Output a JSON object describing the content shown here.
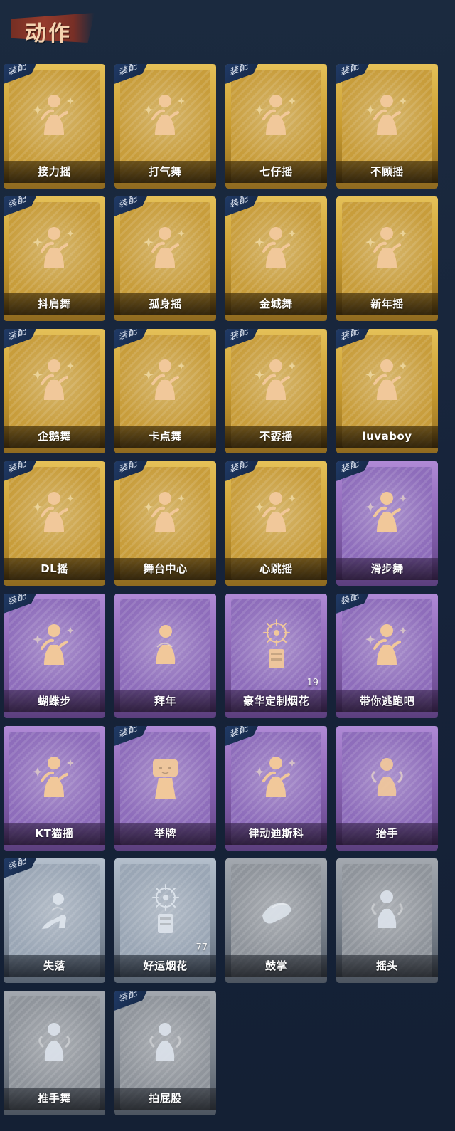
{
  "header": {
    "title": "动作"
  },
  "badge_label": "装配",
  "cards": [
    {
      "label": "接力摇",
      "equipped": true,
      "tier": "gold",
      "icon": "dance-pose-icon"
    },
    {
      "label": "打气舞",
      "equipped": true,
      "tier": "gold",
      "icon": "dance-pose-icon"
    },
    {
      "label": "七仔摇",
      "equipped": true,
      "tier": "gold",
      "icon": "dance-pose-icon"
    },
    {
      "label": "不顾摇",
      "equipped": true,
      "tier": "gold",
      "icon": "dance-pose-icon"
    },
    {
      "label": "抖肩舞",
      "equipped": true,
      "tier": "gold",
      "icon": "dance-pose-icon"
    },
    {
      "label": "孤身摇",
      "equipped": true,
      "tier": "gold",
      "icon": "dance-pose-icon"
    },
    {
      "label": "金城舞",
      "equipped": true,
      "tier": "gold",
      "icon": "dance-pose-icon"
    },
    {
      "label": "新年摇",
      "equipped": false,
      "tier": "gold",
      "icon": "dance-pose-icon"
    },
    {
      "label": "企鹅舞",
      "equipped": true,
      "tier": "gold",
      "icon": "dance-pose-icon"
    },
    {
      "label": "卡点舞",
      "equipped": true,
      "tier": "gold",
      "icon": "dance-pose-icon"
    },
    {
      "label": "不孬摇",
      "equipped": true,
      "tier": "gold",
      "icon": "dance-pose-icon"
    },
    {
      "label": "luvaboy",
      "equipped": true,
      "tier": "gold",
      "icon": "dance-pose-icon"
    },
    {
      "label": "DL摇",
      "equipped": true,
      "tier": "gold",
      "icon": "dance-pose-icon"
    },
    {
      "label": "舞台中心",
      "equipped": true,
      "tier": "gold",
      "icon": "dance-pose-icon"
    },
    {
      "label": "心跳摇",
      "equipped": true,
      "tier": "gold",
      "icon": "dance-pose-icon"
    },
    {
      "label": "滑步舞",
      "equipped": true,
      "tier": "purple",
      "icon": "dance-pose-icon"
    },
    {
      "label": "蝴蝶步",
      "equipped": true,
      "tier": "purple",
      "icon": "dance-pose-icon"
    },
    {
      "label": "拜年",
      "equipped": false,
      "tier": "purple",
      "icon": "greeting-pose-icon"
    },
    {
      "label": "豪华定制烟花",
      "equipped": false,
      "tier": "purple",
      "icon": "fireworks-icon",
      "count": "19"
    },
    {
      "label": "带你逃跑吧",
      "equipped": true,
      "tier": "purple",
      "icon": "dance-pose-icon"
    },
    {
      "label": "KT猫摇",
      "equipped": false,
      "tier": "purple",
      "icon": "dance-pose-icon"
    },
    {
      "label": "举牌",
      "equipped": true,
      "tier": "purple",
      "icon": "sign-pose-icon"
    },
    {
      "label": "律动迪斯科",
      "equipped": true,
      "tier": "purple",
      "icon": "dance-pose-icon"
    },
    {
      "label": "抬手",
      "equipped": false,
      "tier": "purple",
      "icon": "raise-hand-icon"
    },
    {
      "label": "失落",
      "equipped": true,
      "tier": "silver",
      "icon": "crouch-pose-icon"
    },
    {
      "label": "好运烟花",
      "equipped": false,
      "tier": "silver",
      "icon": "fireworks-icon",
      "count": "77"
    },
    {
      "label": "鼓掌",
      "equipped": false,
      "tier": "gray",
      "icon": "clap-icon"
    },
    {
      "label": "摇头",
      "equipped": false,
      "tier": "gray",
      "icon": "shake-head-icon"
    },
    {
      "label": "推手舞",
      "equipped": false,
      "tier": "gray",
      "icon": "push-hand-icon"
    },
    {
      "label": "拍屁股",
      "equipped": true,
      "tier": "gray",
      "icon": "pat-pose-icon"
    }
  ]
}
